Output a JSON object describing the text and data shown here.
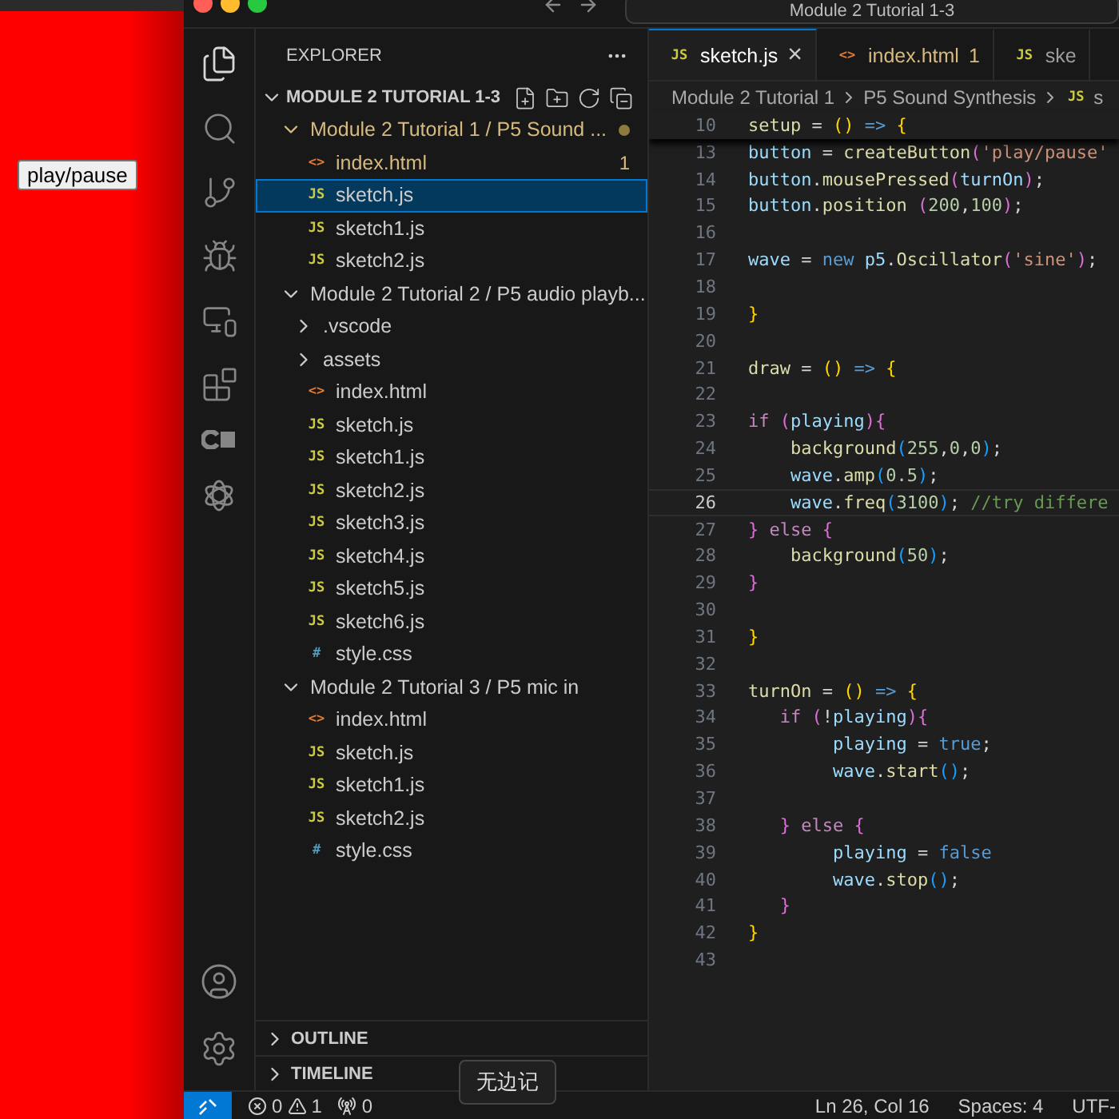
{
  "preview": {
    "button": "play/pause"
  },
  "title_bar": {
    "search": "Module 2 Tutorial 1-3"
  },
  "explorer": {
    "title": "EXPLORER",
    "root": "MODULE 2 TUTORIAL 1-3",
    "tree": [
      {
        "label": "Module 2 Tutorial 1 / P5 Sound ...",
        "kind": "folder",
        "expanded": true,
        "modified": true,
        "children": [
          {
            "label": "index.html",
            "kind": "file",
            "icon": "<>",
            "color": "#e37933",
            "modified": true,
            "problems": "1",
            "selected": false
          },
          {
            "label": "sketch.js",
            "kind": "file",
            "icon": "JS",
            "color": "#cbcb41",
            "modified": false,
            "selected": true
          },
          {
            "label": "sketch1.js",
            "kind": "file",
            "icon": "JS",
            "color": "#cbcb41",
            "modified": false,
            "selected": false
          },
          {
            "label": "sketch2.js",
            "kind": "file",
            "icon": "JS",
            "color": "#cbcb41",
            "modified": false,
            "selected": false
          }
        ]
      },
      {
        "label": "Module 2 Tutorial 2 / P5 audio playb...",
        "kind": "folder",
        "expanded": true,
        "modified": false,
        "children": [
          {
            "label": ".vscode",
            "kind": "folder",
            "expanded": false,
            "modified": false
          },
          {
            "label": "assets",
            "kind": "folder",
            "expanded": false,
            "modified": false
          },
          {
            "label": "index.html",
            "kind": "file",
            "icon": "<>",
            "color": "#e37933",
            "modified": false,
            "selected": false
          },
          {
            "label": "sketch.js",
            "kind": "file",
            "icon": "JS",
            "color": "#cbcb41",
            "modified": false,
            "selected": false
          },
          {
            "label": "sketch1.js",
            "kind": "file",
            "icon": "JS",
            "color": "#cbcb41",
            "modified": false,
            "selected": false
          },
          {
            "label": "sketch2.js",
            "kind": "file",
            "icon": "JS",
            "color": "#cbcb41",
            "modified": false,
            "selected": false
          },
          {
            "label": "sketch3.js",
            "kind": "file",
            "icon": "JS",
            "color": "#cbcb41",
            "modified": false,
            "selected": false
          },
          {
            "label": "sketch4.js",
            "kind": "file",
            "icon": "JS",
            "color": "#cbcb41",
            "modified": false,
            "selected": false
          },
          {
            "label": "sketch5.js",
            "kind": "file",
            "icon": "JS",
            "color": "#cbcb41",
            "modified": false,
            "selected": false
          },
          {
            "label": "sketch6.js",
            "kind": "file",
            "icon": "JS",
            "color": "#cbcb41",
            "modified": false,
            "selected": false
          },
          {
            "label": "style.css",
            "kind": "file",
            "icon": "#",
            "color": "#519aba",
            "modified": false,
            "selected": false
          }
        ]
      },
      {
        "label": "Module 2 Tutorial 3 / P5 mic in",
        "kind": "folder",
        "expanded": true,
        "modified": false,
        "children": [
          {
            "label": "index.html",
            "kind": "file",
            "icon": "<>",
            "color": "#e37933",
            "modified": false,
            "selected": false
          },
          {
            "label": "sketch.js",
            "kind": "file",
            "icon": "JS",
            "color": "#cbcb41",
            "modified": false,
            "selected": false
          },
          {
            "label": "sketch1.js",
            "kind": "file",
            "icon": "JS",
            "color": "#cbcb41",
            "modified": false,
            "selected": false
          },
          {
            "label": "sketch2.js",
            "kind": "file",
            "icon": "JS",
            "color": "#cbcb41",
            "modified": false,
            "selected": false
          },
          {
            "label": "style.css",
            "kind": "file",
            "icon": "#",
            "color": "#519aba",
            "modified": false,
            "selected": false
          }
        ]
      }
    ],
    "panels": [
      {
        "label": "OUTLINE",
        "expanded": false
      },
      {
        "label": "TIMELINE",
        "expanded": false
      }
    ]
  },
  "tabs": [
    {
      "icon": "JS",
      "color": "#cbcb41",
      "label": "sketch.js",
      "selected": true,
      "modified": false,
      "close": "×"
    },
    {
      "icon": "<>",
      "color": "#e37933",
      "label": "index.html",
      "problems": "1",
      "selected": false,
      "modified": true
    },
    {
      "icon": "JS",
      "color": "#cbcb41",
      "label": "ske",
      "selected": false,
      "modified": false
    }
  ],
  "breadcrumbs": [
    {
      "label": "Module 2 Tutorial 1"
    },
    {
      "label": "P5 Sound Synthesis"
    },
    {
      "icon": "JS",
      "color": "#cbcb41",
      "label": "s"
    }
  ],
  "sticky_line": {
    "number": "10",
    "tokens": [
      {
        "kind": "f",
        "text": "setup"
      },
      {
        "kind": "p",
        "text": " = "
      },
      {
        "kind": "b1",
        "text": "()"
      },
      {
        "kind": "c",
        "text": " =>"
      },
      {
        "kind": "b1",
        "text": " {"
      }
    ]
  },
  "code": [
    {
      "number": "13",
      "current": false,
      "tokens": [
        {
          "kind": "v",
          "text": "button"
        },
        {
          "kind": "p",
          "text": " = "
        },
        {
          "kind": "f",
          "text": "createButton"
        },
        {
          "kind": "b2",
          "text": "("
        },
        {
          "kind": "s",
          "text": "'play/pause'"
        }
      ]
    },
    {
      "number": "14",
      "current": false,
      "tokens": [
        {
          "kind": "v",
          "text": "button"
        },
        {
          "kind": "p",
          "text": "."
        },
        {
          "kind": "f",
          "text": "mousePressed"
        },
        {
          "kind": "b2",
          "text": "("
        },
        {
          "kind": "v",
          "text": "turnOn"
        },
        {
          "kind": "b2",
          "text": ")"
        },
        {
          "kind": "p",
          "text": ";"
        }
      ]
    },
    {
      "number": "15",
      "current": false,
      "tokens": [
        {
          "kind": "v",
          "text": "button"
        },
        {
          "kind": "p",
          "text": "."
        },
        {
          "kind": "f",
          "text": "position"
        },
        {
          "kind": "b2",
          "text": " ("
        },
        {
          "kind": "n",
          "text": "200"
        },
        {
          "kind": "p",
          "text": ","
        },
        {
          "kind": "n",
          "text": "100"
        },
        {
          "kind": "b2",
          "text": ")"
        },
        {
          "kind": "p",
          "text": ";"
        }
      ]
    },
    {
      "number": "16",
      "current": false
    },
    {
      "number": "17",
      "current": false,
      "tokens": [
        {
          "kind": "v",
          "text": "wave"
        },
        {
          "kind": "p",
          "text": " = "
        },
        {
          "kind": "c",
          "text": "new"
        },
        {
          "kind": "v",
          "text": " p5"
        },
        {
          "kind": "p",
          "text": "."
        },
        {
          "kind": "f",
          "text": "Oscillator"
        },
        {
          "kind": "b2",
          "text": "("
        },
        {
          "kind": "s",
          "text": "'sine'"
        },
        {
          "kind": "b2",
          "text": ")"
        },
        {
          "kind": "p",
          "text": ";"
        }
      ]
    },
    {
      "number": "18",
      "current": false
    },
    {
      "number": "19",
      "current": false,
      "tokens": [
        {
          "kind": "b1",
          "text": "}"
        }
      ]
    },
    {
      "number": "20",
      "current": false
    },
    {
      "number": "21",
      "current": false,
      "tokens": [
        {
          "kind": "f",
          "text": "draw"
        },
        {
          "kind": "p",
          "text": " = "
        },
        {
          "kind": "b1",
          "text": "()"
        },
        {
          "kind": "c",
          "text": " =>"
        },
        {
          "kind": "b1",
          "text": " {"
        }
      ]
    },
    {
      "number": "22",
      "current": false
    },
    {
      "number": "23",
      "current": false,
      "tokens": [
        {
          "kind": "k",
          "text": "if"
        },
        {
          "kind": "b2",
          "text": " ("
        },
        {
          "kind": "v",
          "text": "playing"
        },
        {
          "kind": "b2",
          "text": "){"
        }
      ]
    },
    {
      "number": "24",
      "current": false,
      "tokens": [
        {
          "kind": "f",
          "text": "    background"
        },
        {
          "kind": "b3",
          "text": "("
        },
        {
          "kind": "n",
          "text": "255"
        },
        {
          "kind": "p",
          "text": ","
        },
        {
          "kind": "n",
          "text": "0"
        },
        {
          "kind": "p",
          "text": ","
        },
        {
          "kind": "n",
          "text": "0"
        },
        {
          "kind": "b3",
          "text": ")"
        },
        {
          "kind": "p",
          "text": ";"
        }
      ]
    },
    {
      "number": "25",
      "current": false,
      "tokens": [
        {
          "kind": "v",
          "text": "    wave"
        },
        {
          "kind": "p",
          "text": "."
        },
        {
          "kind": "f",
          "text": "amp"
        },
        {
          "kind": "b3",
          "text": "("
        },
        {
          "kind": "n",
          "text": "0.5"
        },
        {
          "kind": "b3",
          "text": ")"
        },
        {
          "kind": "p",
          "text": ";"
        }
      ]
    },
    {
      "number": "26",
      "current": true,
      "tokens": [
        {
          "kind": "v",
          "text": "    wave"
        },
        {
          "kind": "p",
          "text": "."
        },
        {
          "kind": "f",
          "text": "freq"
        },
        {
          "kind": "b3",
          "text": "("
        },
        {
          "kind": "n",
          "text": "3100"
        },
        {
          "kind": "b3",
          "text": ")"
        },
        {
          "kind": "p",
          "text": ";"
        },
        {
          "kind": "m",
          "text": " //try differe"
        }
      ]
    },
    {
      "number": "27",
      "current": false,
      "tokens": [
        {
          "kind": "b2",
          "text": "}"
        },
        {
          "kind": "k",
          "text": " else"
        },
        {
          "kind": "b2",
          "text": " {"
        }
      ]
    },
    {
      "number": "28",
      "current": false,
      "tokens": [
        {
          "kind": "f",
          "text": "    background"
        },
        {
          "kind": "b3",
          "text": "("
        },
        {
          "kind": "n",
          "text": "50"
        },
        {
          "kind": "b3",
          "text": ")"
        },
        {
          "kind": "p",
          "text": ";"
        }
      ]
    },
    {
      "number": "29",
      "current": false,
      "tokens": [
        {
          "kind": "b2",
          "text": "}"
        }
      ]
    },
    {
      "number": "30",
      "current": false
    },
    {
      "number": "31",
      "current": false,
      "tokens": [
        {
          "kind": "b1",
          "text": "}"
        }
      ]
    },
    {
      "number": "32",
      "current": false
    },
    {
      "number": "33",
      "current": false,
      "tokens": [
        {
          "kind": "f",
          "text": "turnOn"
        },
        {
          "kind": "p",
          "text": " = "
        },
        {
          "kind": "b1",
          "text": "()"
        },
        {
          "kind": "c",
          "text": " =>"
        },
        {
          "kind": "b1",
          "text": " {"
        }
      ]
    },
    {
      "number": "34",
      "current": false,
      "tokens": [
        {
          "kind": "k",
          "text": "   if"
        },
        {
          "kind": "b2",
          "text": " ("
        },
        {
          "kind": "p",
          "text": "!"
        },
        {
          "kind": "v",
          "text": "playing"
        },
        {
          "kind": "b2",
          "text": "){"
        }
      ]
    },
    {
      "number": "35",
      "current": false,
      "tokens": [
        {
          "kind": "v",
          "text": "        playing"
        },
        {
          "kind": "p",
          "text": " = "
        },
        {
          "kind": "c",
          "text": "true"
        },
        {
          "kind": "p",
          "text": ";"
        }
      ]
    },
    {
      "number": "36",
      "current": false,
      "tokens": [
        {
          "kind": "v",
          "text": "        wave"
        },
        {
          "kind": "p",
          "text": "."
        },
        {
          "kind": "f",
          "text": "start"
        },
        {
          "kind": "b3",
          "text": "()"
        },
        {
          "kind": "p",
          "text": ";"
        }
      ]
    },
    {
      "number": "37",
      "current": false
    },
    {
      "number": "38",
      "current": false,
      "tokens": [
        {
          "kind": "b2",
          "text": "   }"
        },
        {
          "kind": "k",
          "text": " else"
        },
        {
          "kind": "b2",
          "text": " {"
        }
      ]
    },
    {
      "number": "39",
      "current": false,
      "tokens": [
        {
          "kind": "v",
          "text": "        playing"
        },
        {
          "kind": "p",
          "text": " = "
        },
        {
          "kind": "c",
          "text": "false"
        }
      ]
    },
    {
      "number": "40",
      "current": false,
      "tokens": [
        {
          "kind": "v",
          "text": "        wave"
        },
        {
          "kind": "p",
          "text": "."
        },
        {
          "kind": "f",
          "text": "stop"
        },
        {
          "kind": "b3",
          "text": "()"
        },
        {
          "kind": "p",
          "text": ";"
        }
      ]
    },
    {
      "number": "41",
      "current": false,
      "tokens": [
        {
          "kind": "b2",
          "text": "   }"
        }
      ]
    },
    {
      "number": "42",
      "current": false,
      "tokens": [
        {
          "kind": "b1",
          "text": "}"
        }
      ]
    },
    {
      "number": "43",
      "current": false
    }
  ],
  "tooltip": "无边记",
  "status_bar": {
    "errors": "0",
    "warnings": "1",
    "ports": "0",
    "position": "Ln 26, Col 16",
    "spaces": "Spaces: 4",
    "encoding": "UTF-"
  }
}
